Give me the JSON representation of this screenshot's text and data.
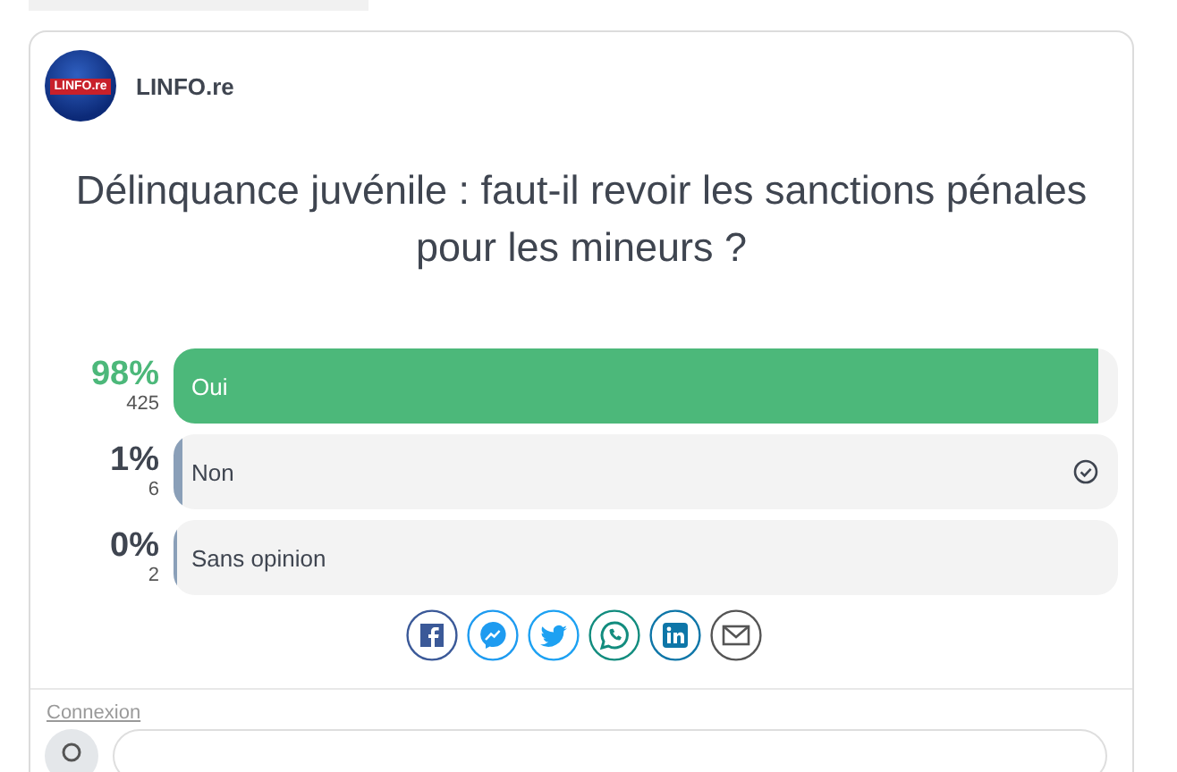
{
  "source": {
    "name": "LINFO.re",
    "logo_text": "LINFO.re"
  },
  "question": "Délinquance juvénile : faut-il revoir les sanctions pénales pour les mineurs ?",
  "options": [
    {
      "label": "Oui",
      "percent": "98%",
      "votes": "425",
      "level": 0.98,
      "leading": true,
      "voted": false
    },
    {
      "label": "Non",
      "percent": "1%",
      "votes": "6",
      "level": 0.01,
      "leading": false,
      "voted": true
    },
    {
      "label": "Sans opinion",
      "percent": "0%",
      "votes": "2",
      "level": 0.0,
      "leading": false,
      "voted": false
    }
  ],
  "share": [
    {
      "kind": "facebook"
    },
    {
      "kind": "messenger"
    },
    {
      "kind": "twitter"
    },
    {
      "kind": "whatsapp"
    },
    {
      "kind": "linkedin"
    },
    {
      "kind": "email"
    }
  ],
  "login_link": "Connexion"
}
